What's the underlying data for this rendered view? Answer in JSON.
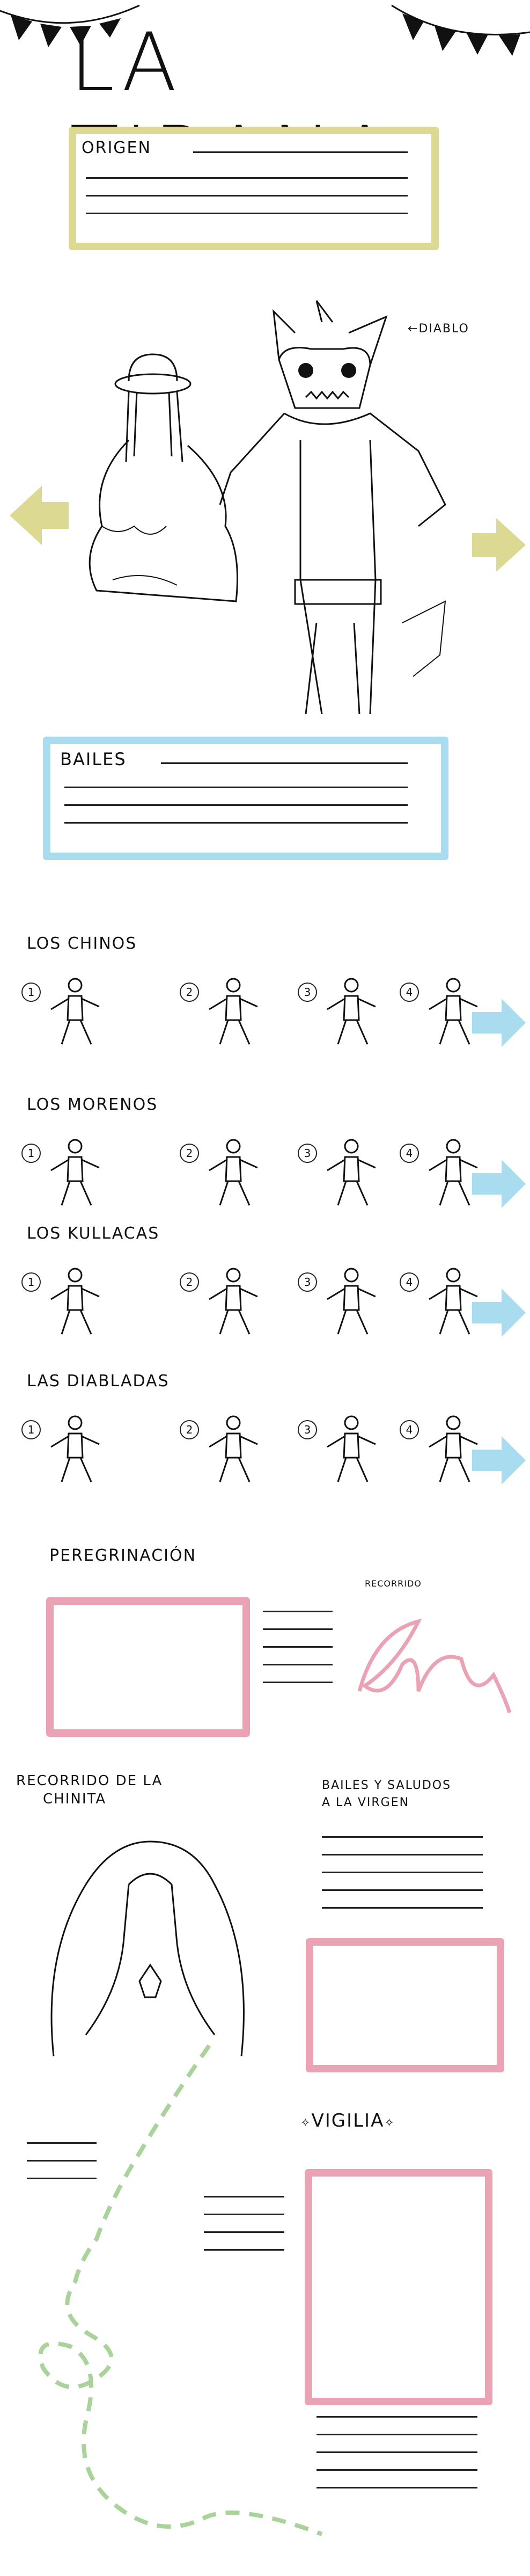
{
  "header": {
    "title": "LA TIRANA"
  },
  "origen": {
    "label": "ORIGEN"
  },
  "figures": {
    "diablo_label": "DIABLO"
  },
  "bailes": {
    "label": "BAILES"
  },
  "dances": [
    {
      "name": "LOS CHINOS",
      "steps": [
        "1",
        "2",
        "3",
        "4"
      ]
    },
    {
      "name": "LOS MORENOS",
      "steps": [
        "1",
        "2",
        "3",
        "4"
      ]
    },
    {
      "name": "LOS KULLACAS",
      "steps": [
        "1",
        "2",
        "3",
        "4"
      ]
    },
    {
      "name": "LAS DIABLADAS",
      "steps": [
        "1",
        "2",
        "3",
        "4"
      ]
    }
  ],
  "peregrinacion": {
    "label": "PEREGRINACIÓN",
    "recorrido_label": "RECORRIDO"
  },
  "chinita": {
    "label_line1": "RECORRIDO DE LA",
    "label_line2": "CHINITA"
  },
  "saludos": {
    "label_line1": "BAILES Y SALUDOS",
    "label_line2": "A LA VIRGEN"
  },
  "vigilia": {
    "label": "VIGILIA"
  },
  "colors": {
    "yellow": "#dcd992",
    "blue": "#a9dcee",
    "pink": "#e9a3b4",
    "green": "#a9d39a"
  },
  "icons": {
    "left_arrow": "left-arrow-icon",
    "right_arrow": "right-arrow-icon"
  }
}
